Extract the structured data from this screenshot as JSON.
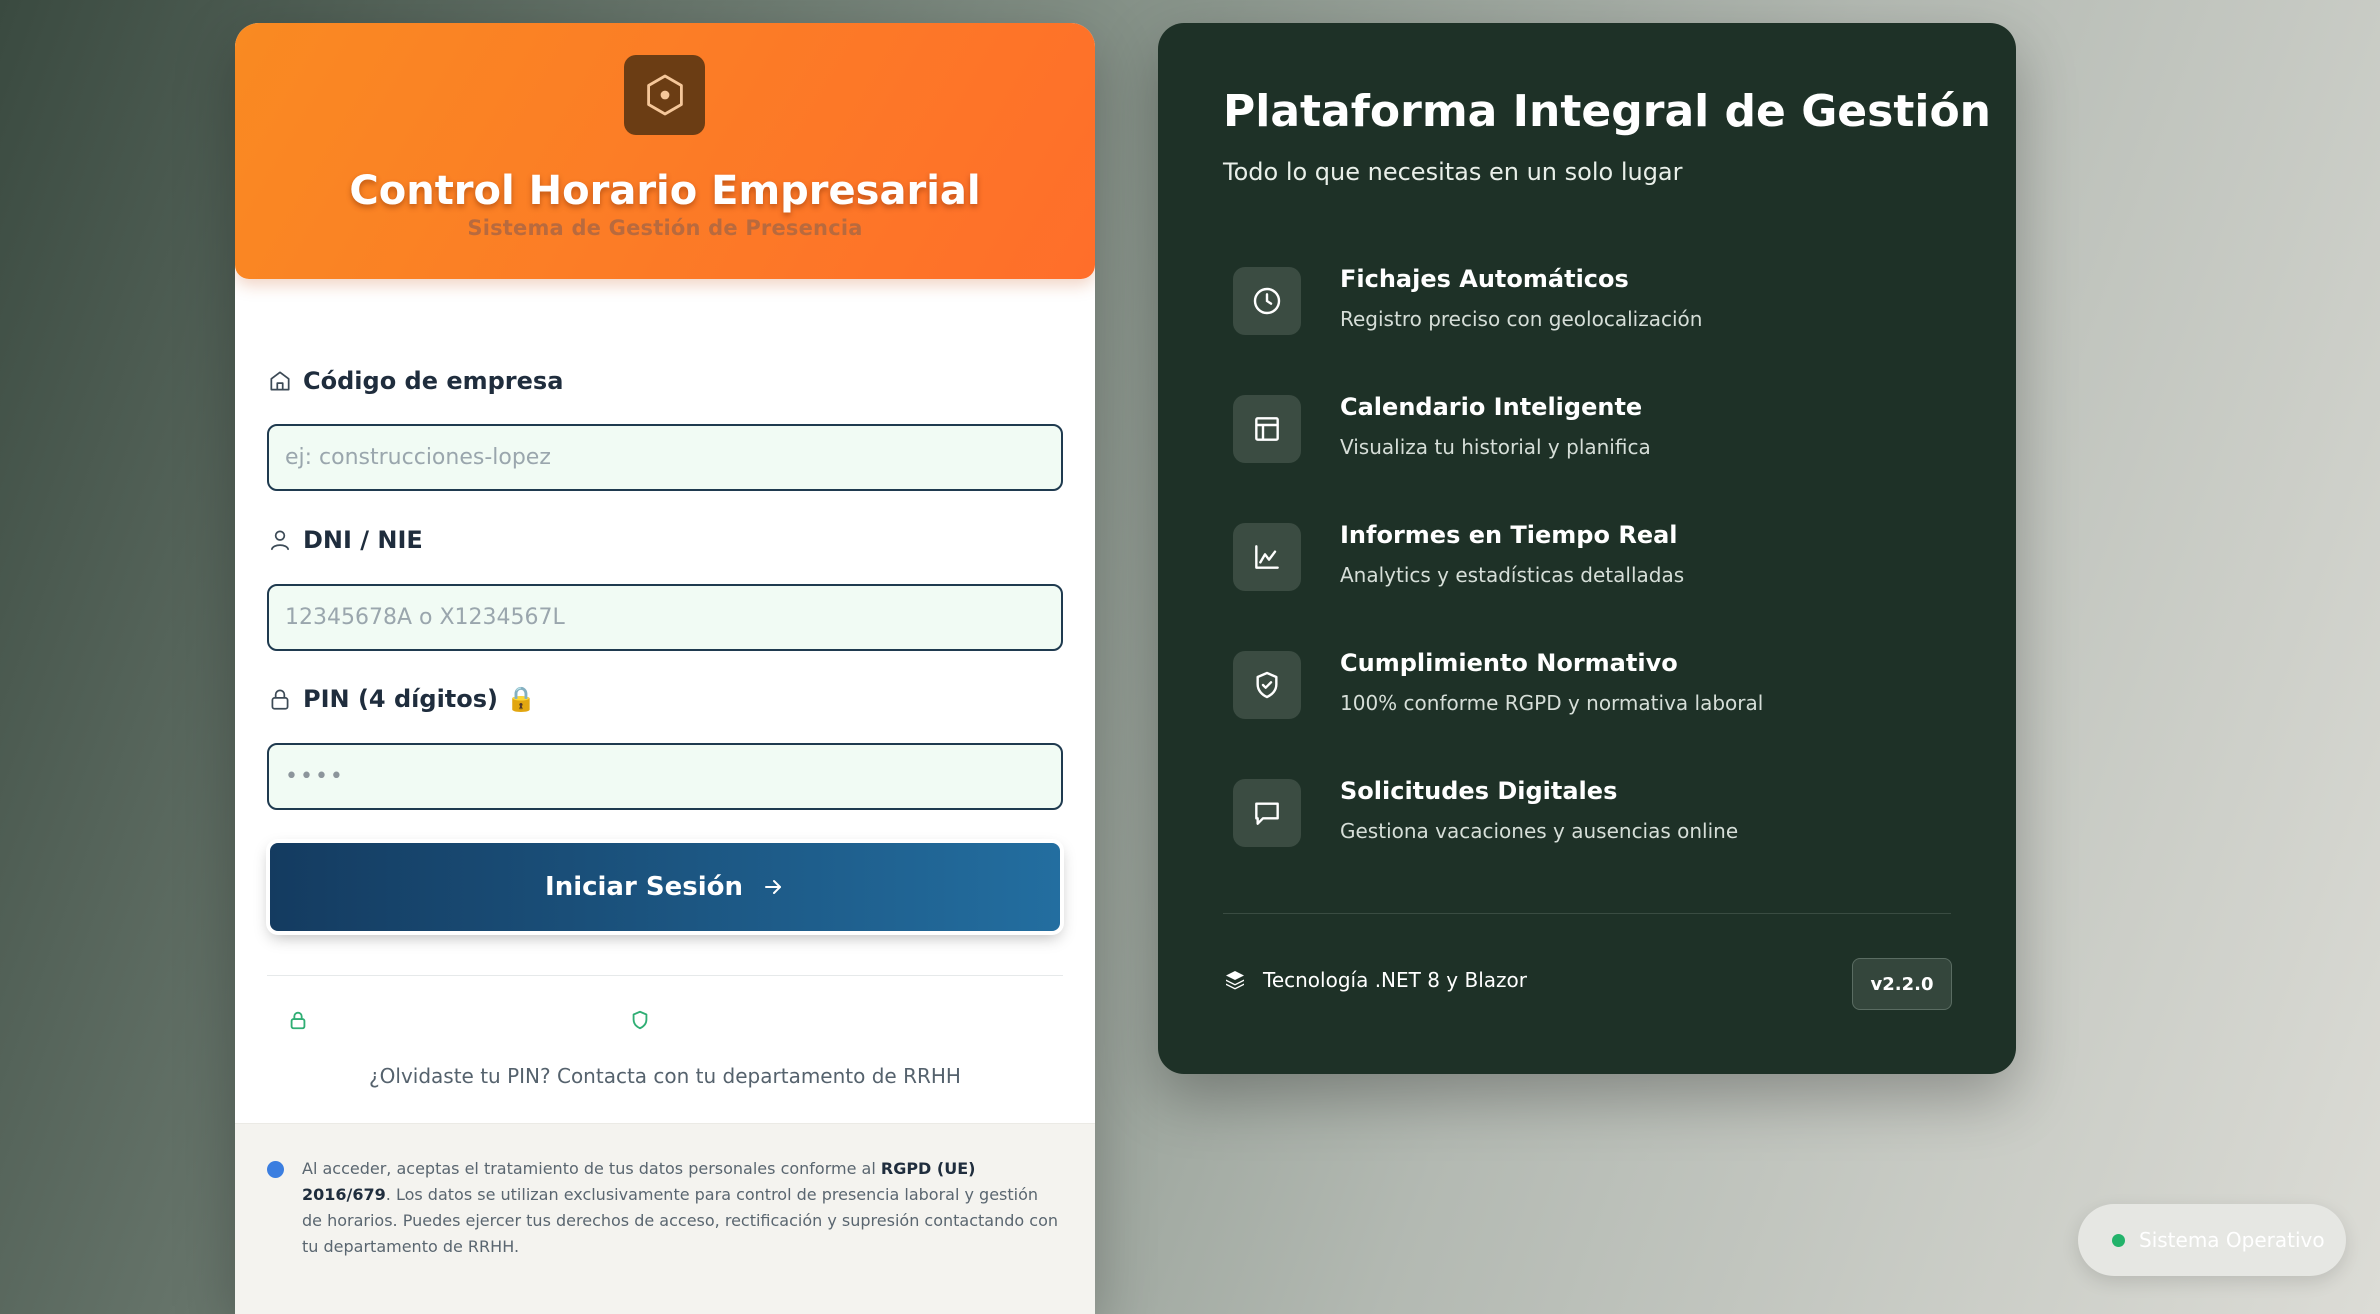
{
  "login": {
    "title": "Control Horario Empresarial",
    "subtitle": "Sistema de Gestión de Presencia",
    "fields": {
      "company": {
        "label": "Código de empresa",
        "placeholder": "ej: construcciones-lopez",
        "value": ""
      },
      "dni": {
        "label": "DNI / NIE",
        "placeholder": "12345678A o X1234567L",
        "value": ""
      },
      "pin": {
        "label": "PIN (4 dígitos) 🔒",
        "placeholder": "••••",
        "value": ""
      }
    },
    "submit_label": "Iniciar Sesión",
    "security_items": [
      "",
      ""
    ],
    "forgot_text": "¿Olvidaste tu PIN? Contacta con tu departamento de RRHH",
    "privacy": {
      "text_before": "Al acceder, aceptas el tratamiento de tus datos personales conforme al ",
      "regulation": "RGPD (UE) 2016/679",
      "text_after": ". Los datos se utilizan exclusivamente para control de presencia laboral y gestión de horarios. Puedes ejercer tus derechos de acceso, rectificación y supresión contactando con tu departamento de RRHH."
    }
  },
  "features_panel": {
    "title": "Plataforma Integral de Gestión",
    "subtitle": "Todo lo que necesitas en un solo lugar",
    "items": [
      {
        "title": "Fichajes Automáticos",
        "description": "Registro preciso con geolocalización",
        "icon": "clock-icon"
      },
      {
        "title": "Calendario Inteligente",
        "description": "Visualiza tu historial y planifica",
        "icon": "layout-icon"
      },
      {
        "title": "Informes en Tiempo Real",
        "description": "Analytics y estadísticas detalladas",
        "icon": "chart-icon"
      },
      {
        "title": "Cumplimiento Normativo",
        "description": "100% conforme RGPD y normativa laboral",
        "icon": "shield-check-icon"
      },
      {
        "title": "Solicitudes Digitales",
        "description": "Gestiona vacaciones y ausencias online",
        "icon": "message-icon"
      }
    ],
    "tech_label": "Tecnología .NET 8 y Blazor",
    "version": "v2.2.0"
  },
  "status": {
    "label": "Sistema Operativo",
    "color": "#22b36a"
  },
  "colors": {
    "accent_orange": "#ff7a22",
    "button_blue": "#1b4f7a",
    "panel_green": "#1e3127"
  }
}
